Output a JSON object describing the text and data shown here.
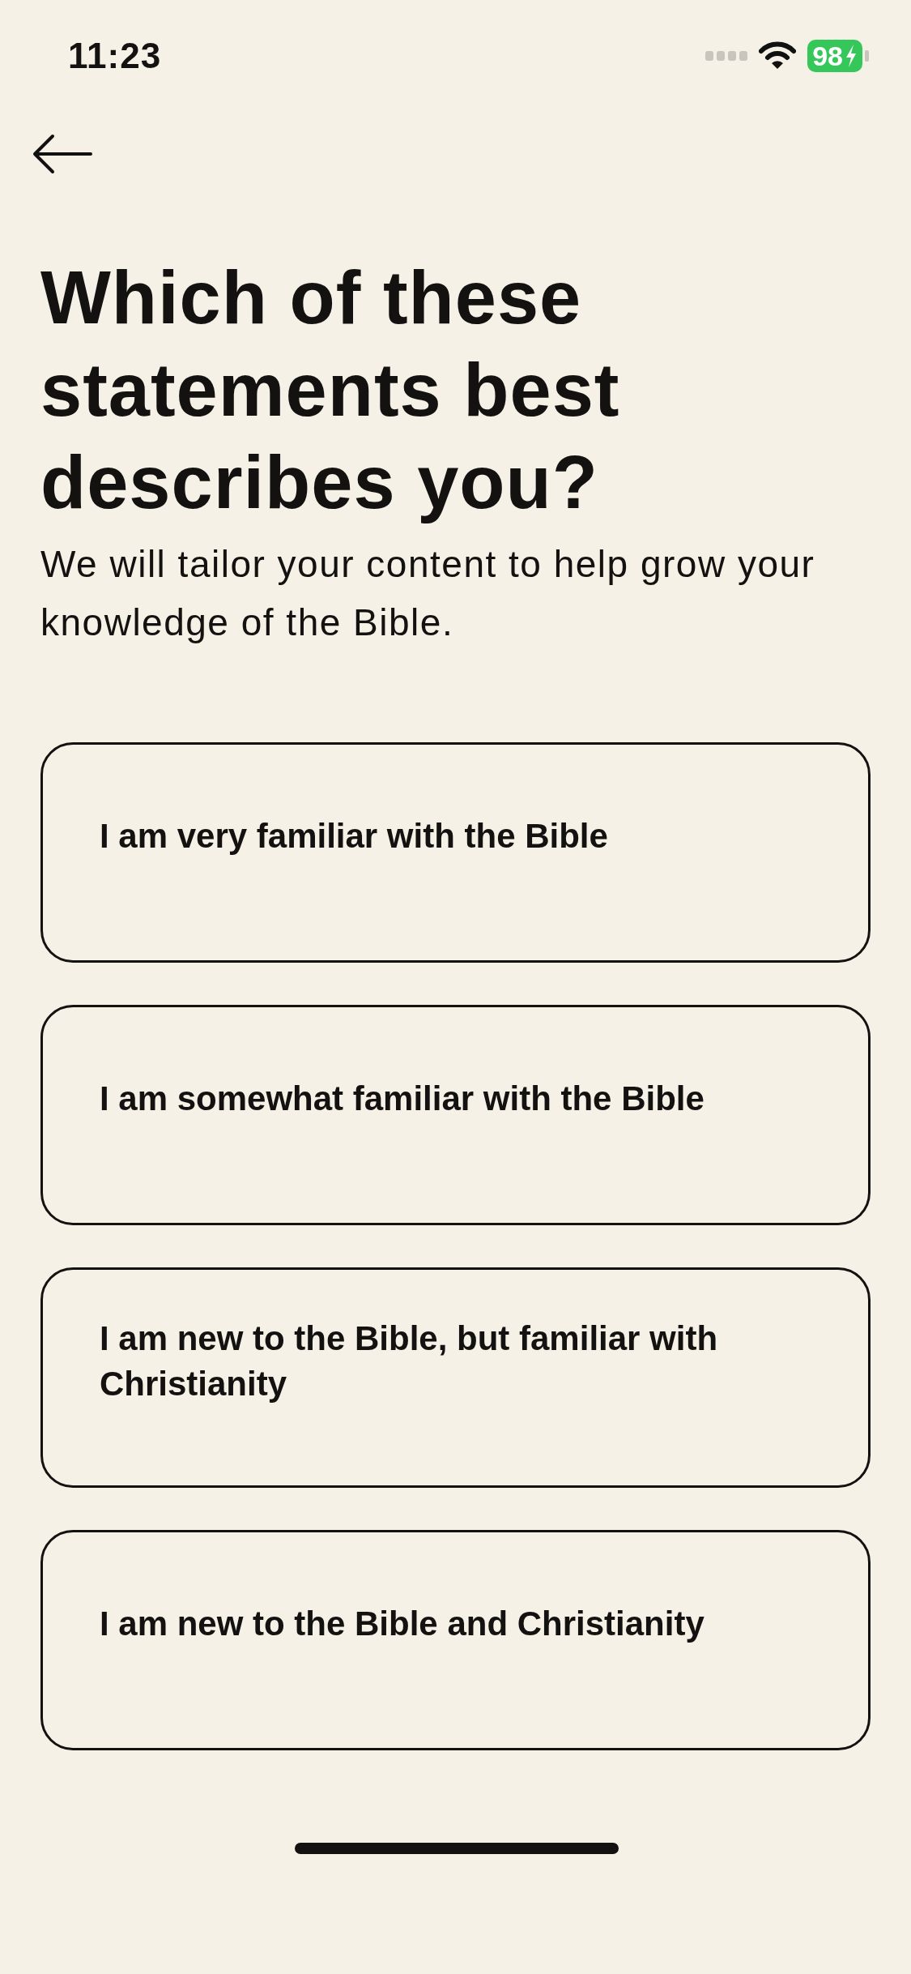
{
  "status_bar": {
    "time": "11:23",
    "battery": "98"
  },
  "title": "Which of these statements best describes you?",
  "subtitle": "We will tailor your content to help grow your knowledge of the Bible.",
  "options": [
    {
      "label": "I am very familiar with the Bible",
      "selected": false
    },
    {
      "label": "I am somewhat familiar with the Bible",
      "selected": false
    },
    {
      "label": "I am new to the Bible, but familiar with Christianity",
      "selected": false
    },
    {
      "label": "I am new to the Bible and Christianity",
      "selected": false
    }
  ]
}
